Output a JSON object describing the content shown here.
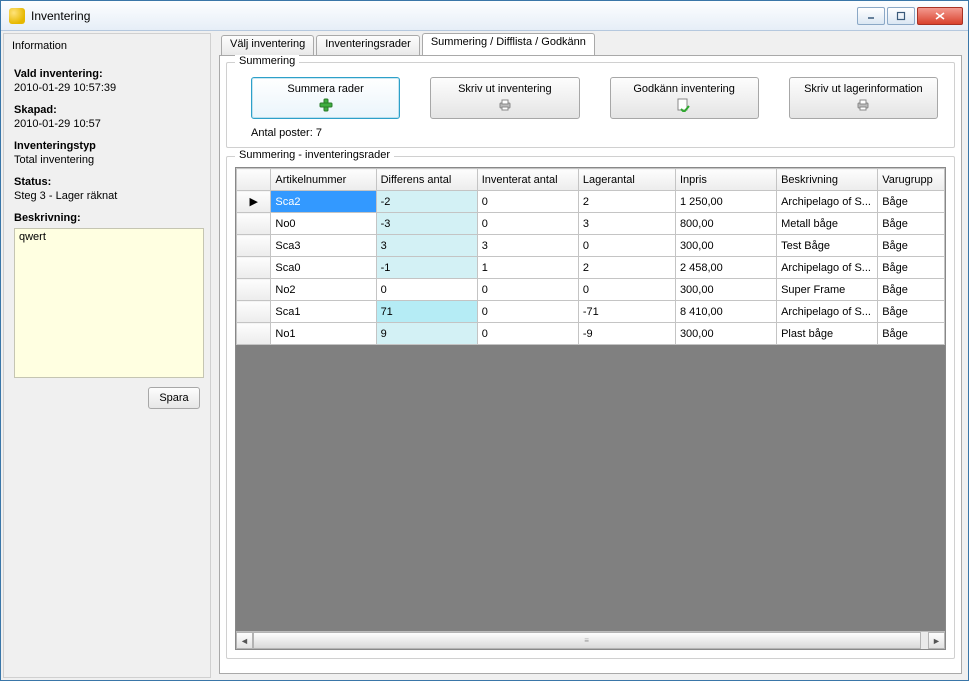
{
  "window": {
    "title": "Inventering"
  },
  "sidebar": {
    "title": "Information",
    "vald_label": "Vald inventering:",
    "vald_value": "2010-01-29 10:57:39",
    "skapad_label": "Skapad:",
    "skapad_value": "2010-01-29 10:57",
    "typ_label": "Inventeringstyp",
    "typ_value": "Total inventering",
    "status_label": "Status:",
    "status_value": "Steg 3 - Lager räknat",
    "beskrivning_label": "Beskrivning:",
    "beskrivning_value": "qwert",
    "spara_label": "Spara"
  },
  "tabs": [
    {
      "label": "Välj inventering"
    },
    {
      "label": "Inventeringsrader"
    },
    {
      "label": "Summering / Difflista / Godkänn"
    }
  ],
  "summering": {
    "legend": "Summering",
    "summera_label": "Summera rader",
    "skrivut_inv_label": "Skriv ut inventering",
    "godkann_label": "Godkänn inventering",
    "skrivut_lager_label": "Skriv ut lagerinformation",
    "count_prefix": "Antal poster: ",
    "count_value": "7"
  },
  "grid": {
    "legend": "Summering - inventeringsrader",
    "headers": {
      "artikelnummer": "Artikelnummer",
      "differens": "Differens antal",
      "inventerat": "Inventerat antal",
      "lagerantal": "Lagerantal",
      "inpris": "Inpris",
      "beskrivning": "Beskrivning",
      "varugrupp": "Varugrupp"
    },
    "rows": [
      {
        "art": "Sca2",
        "diff": "-2",
        "inv": "0",
        "lager": "2",
        "inpris": "1 250,00",
        "besk": "Archipelago of S...",
        "vg": "Båge"
      },
      {
        "art": "No0",
        "diff": "-3",
        "inv": "0",
        "lager": "3",
        "inpris": "800,00",
        "besk": "Metall båge",
        "vg": "Båge"
      },
      {
        "art": "Sca3",
        "diff": "3",
        "inv": "3",
        "lager": "0",
        "inpris": "300,00",
        "besk": "Test Båge",
        "vg": "Båge"
      },
      {
        "art": "Sca0",
        "diff": "-1",
        "inv": "1",
        "lager": "2",
        "inpris": "2 458,00",
        "besk": "Archipelago of S...",
        "vg": "Båge"
      },
      {
        "art": "No2",
        "diff": "0",
        "inv": "0",
        "lager": "0",
        "inpris": "300,00",
        "besk": "Super Frame",
        "vg": "Båge"
      },
      {
        "art": "Sca1",
        "diff": "71",
        "inv": "0",
        "lager": "-71",
        "inpris": "8 410,00",
        "besk": "Archipelago of S...",
        "vg": "Båge"
      },
      {
        "art": "No1",
        "diff": "9",
        "inv": "0",
        "lager": "-9",
        "inpris": "300,00",
        "besk": "Plast båge",
        "vg": "Båge"
      }
    ]
  }
}
